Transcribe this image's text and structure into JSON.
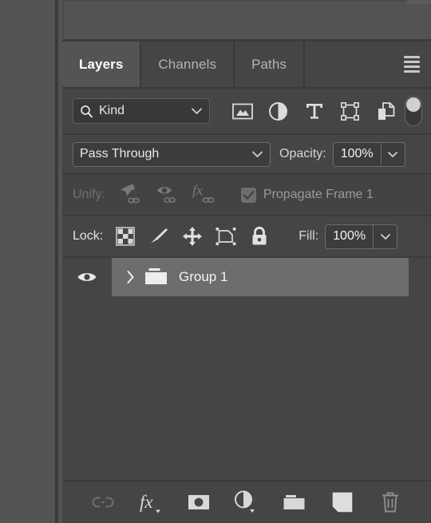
{
  "panel": {
    "tabs": [
      {
        "label": "Layers",
        "active": true
      },
      {
        "label": "Channels",
        "active": false
      },
      {
        "label": "Paths",
        "active": false
      }
    ],
    "menu_icon": "hamburger-menu-icon"
  },
  "filter": {
    "kind_label": "Kind",
    "search_icon": "search-icon",
    "chevron_icon": "chevron-down-icon",
    "type_icons": [
      "pixel-layer-filter-icon",
      "adjustment-layer-filter-icon",
      "type-layer-filter-icon",
      "shape-layer-filter-icon",
      "smart-object-filter-icon"
    ],
    "toggle": "filter-enable-toggle"
  },
  "blend": {
    "mode": "Pass Through",
    "opacity_label": "Opacity:",
    "opacity_value": "100%"
  },
  "unify": {
    "label": "Unify:",
    "icons": [
      "unify-position-icon",
      "unify-visibility-icon",
      "unify-style-icon"
    ],
    "propagate_label": "Propagate Frame 1",
    "propagate_checked": true,
    "enabled": false
  },
  "lock": {
    "label": "Lock:",
    "icons": [
      "lock-transparency-icon",
      "lock-image-pixels-icon",
      "lock-position-icon",
      "lock-artboard-nesting-icon",
      "lock-all-icon"
    ],
    "fill_label": "Fill:",
    "fill_value": "100%"
  },
  "layers": [
    {
      "name": "Group 1",
      "visible": true,
      "selected": true,
      "expanded": false,
      "kind": "group",
      "visibility_icon": "eye-icon",
      "twisty_icon": "chevron-right-icon",
      "thumb_icon": "folder-icon"
    }
  ],
  "bottom_toolbar": [
    {
      "name": "link-layers-button",
      "icon": "link-icon",
      "enabled": false
    },
    {
      "name": "layer-style-button",
      "icon": "fx-icon",
      "enabled": true
    },
    {
      "name": "add-layer-mask-button",
      "icon": "layer-mask-icon",
      "enabled": true
    },
    {
      "name": "new-adjustment-button",
      "icon": "adjustment-icon",
      "enabled": true
    },
    {
      "name": "new-group-button",
      "icon": "folder-icon",
      "enabled": true
    },
    {
      "name": "new-layer-button",
      "icon": "new-layer-icon",
      "enabled": true
    },
    {
      "name": "delete-layer-button",
      "icon": "trash-icon",
      "enabled": false
    }
  ],
  "colors": {
    "panel_bg": "#454545",
    "dock_bg": "#535353",
    "tab_active": "#545454",
    "row_selected": "#6d6d6d",
    "text": "#e6e6e6",
    "text_dim": "#707070"
  }
}
